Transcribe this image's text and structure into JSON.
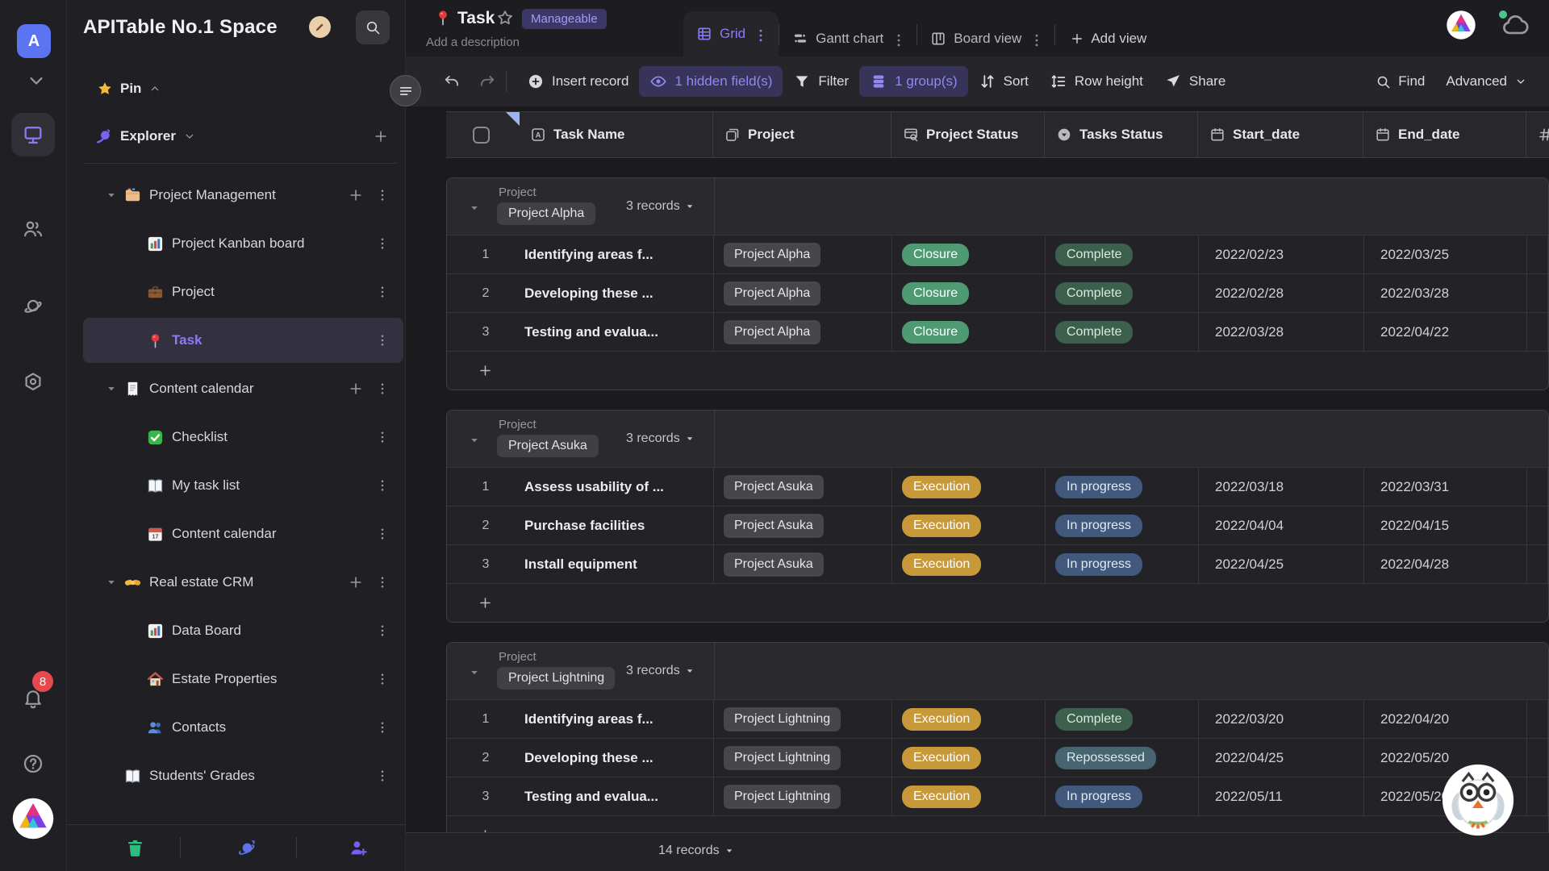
{
  "colors": {
    "closure": {
      "bg": "#4D9A73",
      "fg": "#FFFFFF"
    },
    "complete": {
      "bg": "#3D5F4E",
      "fg": "#D9EBE0"
    },
    "execution": {
      "bg": "#C7993A",
      "fg": "#FFFFFF"
    },
    "in_progress": {
      "bg": "#40597D",
      "fg": "#E2EAF4"
    },
    "repossessed": {
      "bg": "#476471",
      "fg": "#DCE8ED"
    },
    "accent": "#8b7cf5"
  },
  "rail": {
    "avatar_letter": "A",
    "notification_count": "8"
  },
  "sidebar": {
    "title": "APITable No.1 Space",
    "pin_label": "Pin",
    "explorer_label": "Explorer",
    "tree": [
      {
        "label": "Project Management",
        "icon": "folder",
        "level": 0,
        "expandable": true,
        "has_add": true,
        "selected": false
      },
      {
        "label": "Project Kanban board",
        "icon": "chart",
        "level": 1,
        "expandable": false,
        "has_add": false,
        "selected": false
      },
      {
        "label": "Project",
        "icon": "briefcase",
        "level": 1,
        "expandable": false,
        "has_add": false,
        "selected": false
      },
      {
        "label": "Task",
        "icon": "pushpin",
        "level": 1,
        "expandable": false,
        "has_add": false,
        "selected": true
      },
      {
        "label": "Content calendar",
        "icon": "receipt",
        "level": 0,
        "expandable": true,
        "has_add": true,
        "selected": false
      },
      {
        "label": "Checklist",
        "icon": "checklist",
        "level": 1,
        "expandable": false,
        "has_add": false,
        "selected": false
      },
      {
        "label": "My task list",
        "icon": "book",
        "level": 1,
        "expandable": false,
        "has_add": false,
        "selected": false
      },
      {
        "label": "Content calendar",
        "icon": "calendar",
        "level": 1,
        "expandable": false,
        "has_add": false,
        "selected": false
      },
      {
        "label": "Real estate CRM",
        "icon": "handshake",
        "level": 0,
        "expandable": true,
        "has_add": true,
        "selected": false
      },
      {
        "label": "Data Board",
        "icon": "chart",
        "level": 1,
        "expandable": false,
        "has_add": false,
        "selected": false
      },
      {
        "label": "Estate Properties",
        "icon": "house",
        "level": 1,
        "expandable": false,
        "has_add": false,
        "selected": false
      },
      {
        "label": "Contacts",
        "icon": "people",
        "level": 1,
        "expandable": false,
        "has_add": false,
        "selected": false
      },
      {
        "label": "Students' Grades",
        "icon": "book",
        "level": 0,
        "expandable": false,
        "has_add": false,
        "selected": false
      }
    ]
  },
  "header": {
    "title": "Task",
    "badge": "Manageable",
    "description_placeholder": "Add a description",
    "views": [
      {
        "label": "Grid",
        "icon": "grid",
        "active": true
      },
      {
        "label": "Gantt chart",
        "icon": "gantt",
        "active": false
      },
      {
        "label": "Board view",
        "icon": "board",
        "active": false
      }
    ],
    "add_view_label": "Add view"
  },
  "toolbar": {
    "insert_record": "Insert record",
    "hidden_fields": "1 hidden field(s)",
    "filter": "Filter",
    "groups": "1 group(s)",
    "sort": "Sort",
    "row_height": "Row height",
    "share": "Share",
    "find": "Find",
    "advanced": "Advanced"
  },
  "grid": {
    "columns": [
      {
        "label": "Task Name",
        "icon": "field-text"
      },
      {
        "label": "Project",
        "icon": "field-link"
      },
      {
        "label": "Project Status",
        "icon": "field-lookup"
      },
      {
        "label": "Tasks Status",
        "icon": "field-select"
      },
      {
        "label": "Start_date",
        "icon": "field-date"
      },
      {
        "label": "End_date",
        "icon": "field-date"
      }
    ],
    "partial_column_icon": "hash",
    "group_field_label": "Project",
    "groups": [
      {
        "chip": "Project Alpha",
        "records_label": "3 records",
        "rows": [
          {
            "num": "1",
            "name": "Identifying areas f...",
            "project": "Project Alpha",
            "project_status": {
              "key": "closure",
              "label": "Closure"
            },
            "tasks_status": {
              "key": "complete",
              "label": "Complete"
            },
            "start": "2022/02/23",
            "end": "2022/03/25"
          },
          {
            "num": "2",
            "name": "Developing these ...",
            "project": "Project Alpha",
            "project_status": {
              "key": "closure",
              "label": "Closure"
            },
            "tasks_status": {
              "key": "complete",
              "label": "Complete"
            },
            "start": "2022/02/28",
            "end": "2022/03/28"
          },
          {
            "num": "3",
            "name": "Testing and evalua...",
            "project": "Project Alpha",
            "project_status": {
              "key": "closure",
              "label": "Closure"
            },
            "tasks_status": {
              "key": "complete",
              "label": "Complete"
            },
            "start": "2022/03/28",
            "end": "2022/04/22"
          }
        ]
      },
      {
        "chip": "Project Asuka",
        "records_label": "3 records",
        "rows": [
          {
            "num": "1",
            "name": "Assess usability of ...",
            "project": "Project Asuka",
            "project_status": {
              "key": "execution",
              "label": "Execution"
            },
            "tasks_status": {
              "key": "in_progress",
              "label": "In progress"
            },
            "start": "2022/03/18",
            "end": "2022/03/31"
          },
          {
            "num": "2",
            "name": "Purchase facilities",
            "project": "Project Asuka",
            "project_status": {
              "key": "execution",
              "label": "Execution"
            },
            "tasks_status": {
              "key": "in_progress",
              "label": "In progress"
            },
            "start": "2022/04/04",
            "end": "2022/04/15"
          },
          {
            "num": "3",
            "name": "Install equipment",
            "project": "Project Asuka",
            "project_status": {
              "key": "execution",
              "label": "Execution"
            },
            "tasks_status": {
              "key": "in_progress",
              "label": "In progress"
            },
            "start": "2022/04/25",
            "end": "2022/04/28"
          }
        ]
      },
      {
        "chip": "Project Lightning",
        "records_label": "3 records",
        "rows": [
          {
            "num": "1",
            "name": "Identifying areas f...",
            "project": "Project Lightning",
            "project_status": {
              "key": "execution",
              "label": "Execution"
            },
            "tasks_status": {
              "key": "complete",
              "label": "Complete"
            },
            "start": "2022/03/20",
            "end": "2022/04/20"
          },
          {
            "num": "2",
            "name": "Developing these ...",
            "project": "Project Lightning",
            "project_status": {
              "key": "execution",
              "label": "Execution"
            },
            "tasks_status": {
              "key": "repossessed",
              "label": "Repossessed"
            },
            "start": "2022/04/25",
            "end": "2022/05/20"
          },
          {
            "num": "3",
            "name": "Testing and evalua...",
            "project": "Project Lightning",
            "project_status": {
              "key": "execution",
              "label": "Execution"
            },
            "tasks_status": {
              "key": "in_progress",
              "label": "In progress"
            },
            "start": "2022/05/11",
            "end": "2022/05/20"
          }
        ]
      }
    ],
    "footer_records_label": "14 records"
  }
}
